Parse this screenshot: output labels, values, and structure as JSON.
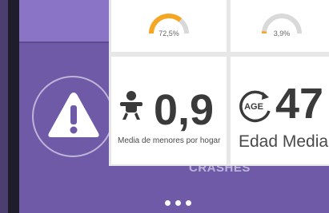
{
  "background_slide": {
    "alert_icon": "warning-triangle-icon",
    "title": "CRASHES",
    "pager_dots": 3
  },
  "tiles": [
    {
      "gauge_value": "72,5%",
      "gauge_fraction": 0.725,
      "color": "#f5a623"
    },
    {
      "gauge_value": "3,9%",
      "gauge_fraction": 0.039,
      "color": "#f5a623"
    },
    {
      "icon": "baby-icon",
      "value": "0,9",
      "caption": "Media de menores por hogar"
    },
    {
      "icon": "age-icon",
      "icon_text": "AGE",
      "value": "47",
      "caption": "Edad Media"
    }
  ],
  "colors": {
    "accent": "#f5a623",
    "gauge_track": "#d9d9d9",
    "panel": "#6f5aa8",
    "text_dark": "#3a3a3a"
  }
}
